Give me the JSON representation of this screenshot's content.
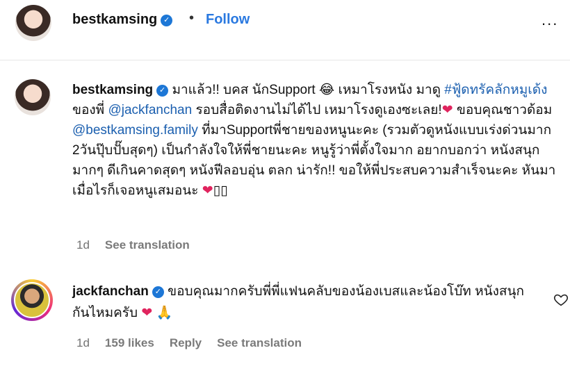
{
  "header": {
    "username": "bestkamsing",
    "separator": "•",
    "follow_label": "Follow",
    "more_icon": "..."
  },
  "caption": {
    "username": "bestkamsing",
    "text_a": "มาแล้ว!! บคส นักSupport",
    "emoji_a": "😂",
    "text_b": "เหมาโรงหนัง มาดู",
    "hashtag": "#ฟู้ดทรัคลักหมูเด้ง",
    "text_c": "ของพี่",
    "mention_a": "@jackfanchan",
    "text_d": "รอบสื่อติดงานไม่ได้ไป เหมาโรงดูเองซะเลย!",
    "emoji_b": "❤",
    "text_e": "ขอบคุณชาวด้อม",
    "mention_b": "@bestkamsing.family",
    "text_f": "ที่มาSupportพี่ชายของหนูนะคะ (รวมตัวดูหนังแบบเร่งด่วนมาก 2วันปุ๊บปั๊บสุดๆ) เป็นกำลังใจให้พี่ชายนะคะ หนูรู้ว่าพี่ตั้งใจมาก อยากบอกว่า หนังสนุกมากๆ ดีเกินคาดสุดๆ หนังฟีลอบอุ่น ตลก น่ารัก!! ขอให้พี่ประสบความสำเร็จนะคะ หันมาเมื่อไรก็เจอหนูเสมอนะ",
    "emoji_c": "❤",
    "trailing": "▯▯",
    "time": "1d",
    "see_translation": "See translation"
  },
  "comment": {
    "username": "jackfanchan",
    "text_a": "ขอบคุณมากครับพี่พี่แฟนคลับของน้องเบสและน้องโบ๊ท หนังสนุกกันไหมครับ",
    "emoji_a": "❤",
    "emoji_b": "🙏",
    "time": "1d",
    "likes": "159 likes",
    "reply": "Reply",
    "see_translation": "See translation"
  },
  "icons": {
    "verified": "verified-badge-icon",
    "like": "heart-outline-icon"
  }
}
